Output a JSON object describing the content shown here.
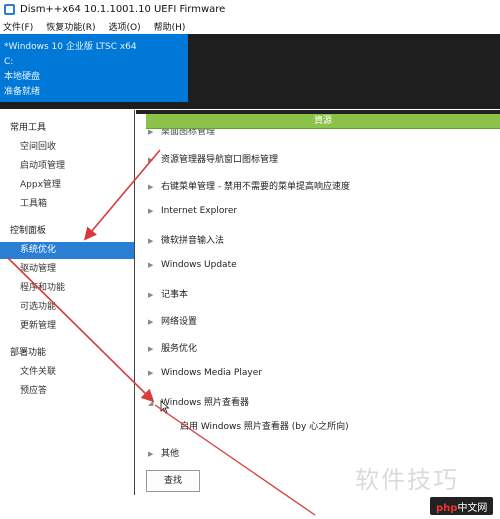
{
  "window": {
    "title": "Dism++x64 10.1.1001.10 UEFI Firmware"
  },
  "menu": [
    "文件(F)",
    "恢复功能(R)",
    "选项(O)",
    "帮助(H)"
  ],
  "image_panel": {
    "lines": [
      "*Windows 10 企业版 LTSC x64",
      "C:",
      "本地硬盘",
      "准备就绪"
    ]
  },
  "sidebar": {
    "groups": [
      {
        "label": "常用工具",
        "items": [
          "空间回收",
          "启动项管理",
          "Appx管理",
          "工具箱"
        ]
      },
      {
        "label": "控制面板",
        "items": [
          "系统优化",
          "驱动管理",
          "程序和功能",
          "可选功能",
          "更新管理"
        ]
      },
      {
        "label": "部署功能",
        "items": [
          "文件关联",
          "预应答"
        ]
      }
    ],
    "selected": "系统优化"
  },
  "content": {
    "header": "資源",
    "first_row_partial": "桌面图标管理",
    "rows": [
      "资源管理器导航窗口图标管理",
      "右键菜单管理 - 禁用不需要的菜单提高响应速度",
      "Internet Explorer",
      "微软拼音输入法",
      "Windows Update",
      "记事本",
      "网络设置",
      "服务优化",
      "Windows Media Player",
      "Windows 照片查看器",
      "其他"
    ],
    "expanded_child": "启用 Windows 照片查看器 (by 心之所向)"
  },
  "buttons": {
    "find": "查找"
  },
  "watermark": {
    "text": "软件技巧",
    "logo_php": "php",
    "logo_rest": "中文网"
  },
  "colors": {
    "accent_blue": "#0078d7",
    "selected_blue": "#2a7fd4",
    "header_green": "#8bc34a",
    "annotation_red": "#d93a3a"
  }
}
